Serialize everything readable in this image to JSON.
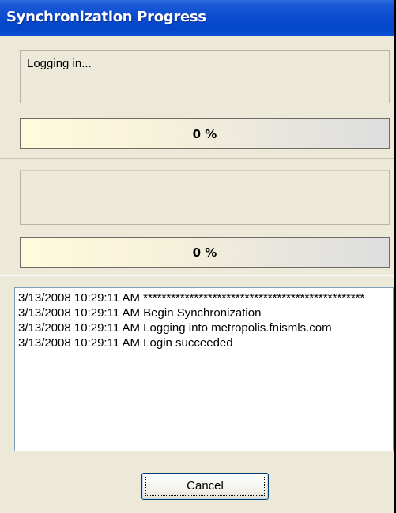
{
  "window": {
    "title": "Synchronization Progress"
  },
  "status_1": {
    "text": "Logging in..."
  },
  "progress_1": {
    "value_percent": 0,
    "label": "0 %"
  },
  "status_2": {
    "text": ""
  },
  "progress_2": {
    "value_percent": 0,
    "label": "0 %"
  },
  "log": {
    "lines": [
      "3/13/2008 10:29:11 AM ************************************************",
      "3/13/2008 10:29:11 AM Begin Synchronization",
      "3/13/2008 10:29:11 AM Logging into metropolis.fnismls.com",
      "3/13/2008 10:29:11 AM Login succeeded"
    ]
  },
  "buttons": {
    "cancel_label": "Cancel"
  },
  "colors": {
    "titlebar": "#0a4bd0",
    "window_bg": "#ece9d8",
    "progress_fill": "#2a5bd7"
  }
}
